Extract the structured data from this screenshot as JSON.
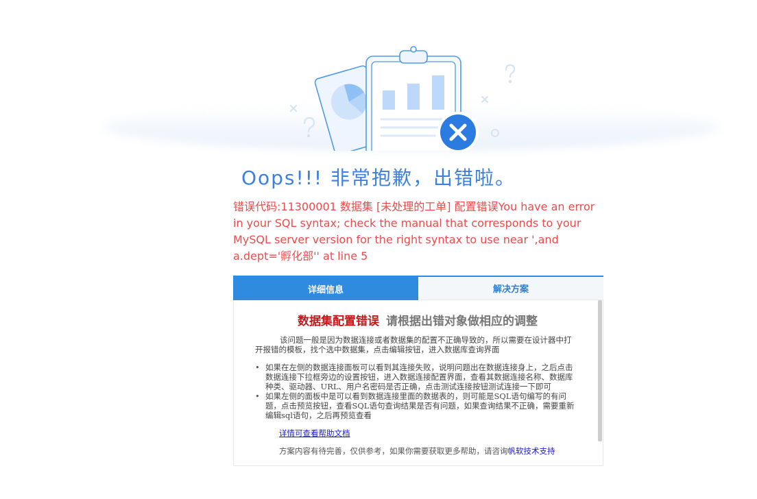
{
  "page": {
    "title": "Oops!!! 非常抱歉，出错啦。",
    "error_message": "错误代码:11300001 数据集 [未处理的工单] 配置错误You have an error in your SQL syntax; check the manual that corresponds to your MySQL server version for the right syntax to use near ',and a.dept='孵化部'' at line 5"
  },
  "tabs": [
    {
      "label": "详细信息",
      "active": true
    },
    {
      "label": "解决方案",
      "active": false
    }
  ],
  "details": {
    "heading_red": "数据集配置错误",
    "heading_gray": "请根据出错对象做相应的调整",
    "intro": "该问题一般是因为数据连接或者数据集的配置不正确导致的，所以需要在设计器中打开报错的模板，找个选中数据集，点击编辑按钮，进入数据库查询界面",
    "bullets": [
      "如果在左侧的数据连接面板可以看到其连接失败，说明问题出在数据连接身上，之后点击数据连接下拉框旁边的设置按钮，进入数据连接配置界面，查看其数据连接名称、数据库种类、驱动器、URL、用户名密码是否正确，点击测试连接按钮测试连接一下即可",
      "如果左侧的面板中是可以看到数据连接里面的数据表的，则可能是SQL语句编写的有问题，点击预览按钮，查看SQL语句查询结果是否有问题，如果查询结果不正确，需要重新编辑sql语句，之后再预览查看"
    ],
    "bullet_symbol": "•",
    "help_link": "详情可查看帮助文档",
    "footer_note": "方案内容有待完善，仅供参考，如果你需要获取更多帮助，请咨询",
    "support_link": "帆软技术支持"
  },
  "colors": {
    "accent": "#2f8be0",
    "title": "#3d80de",
    "error": "#ef4a4a",
    "heading_red": "#c21a1a"
  },
  "icons": [
    "clipboard-chart-icon",
    "error-x-icon",
    "pie-chart-card-icon"
  ]
}
